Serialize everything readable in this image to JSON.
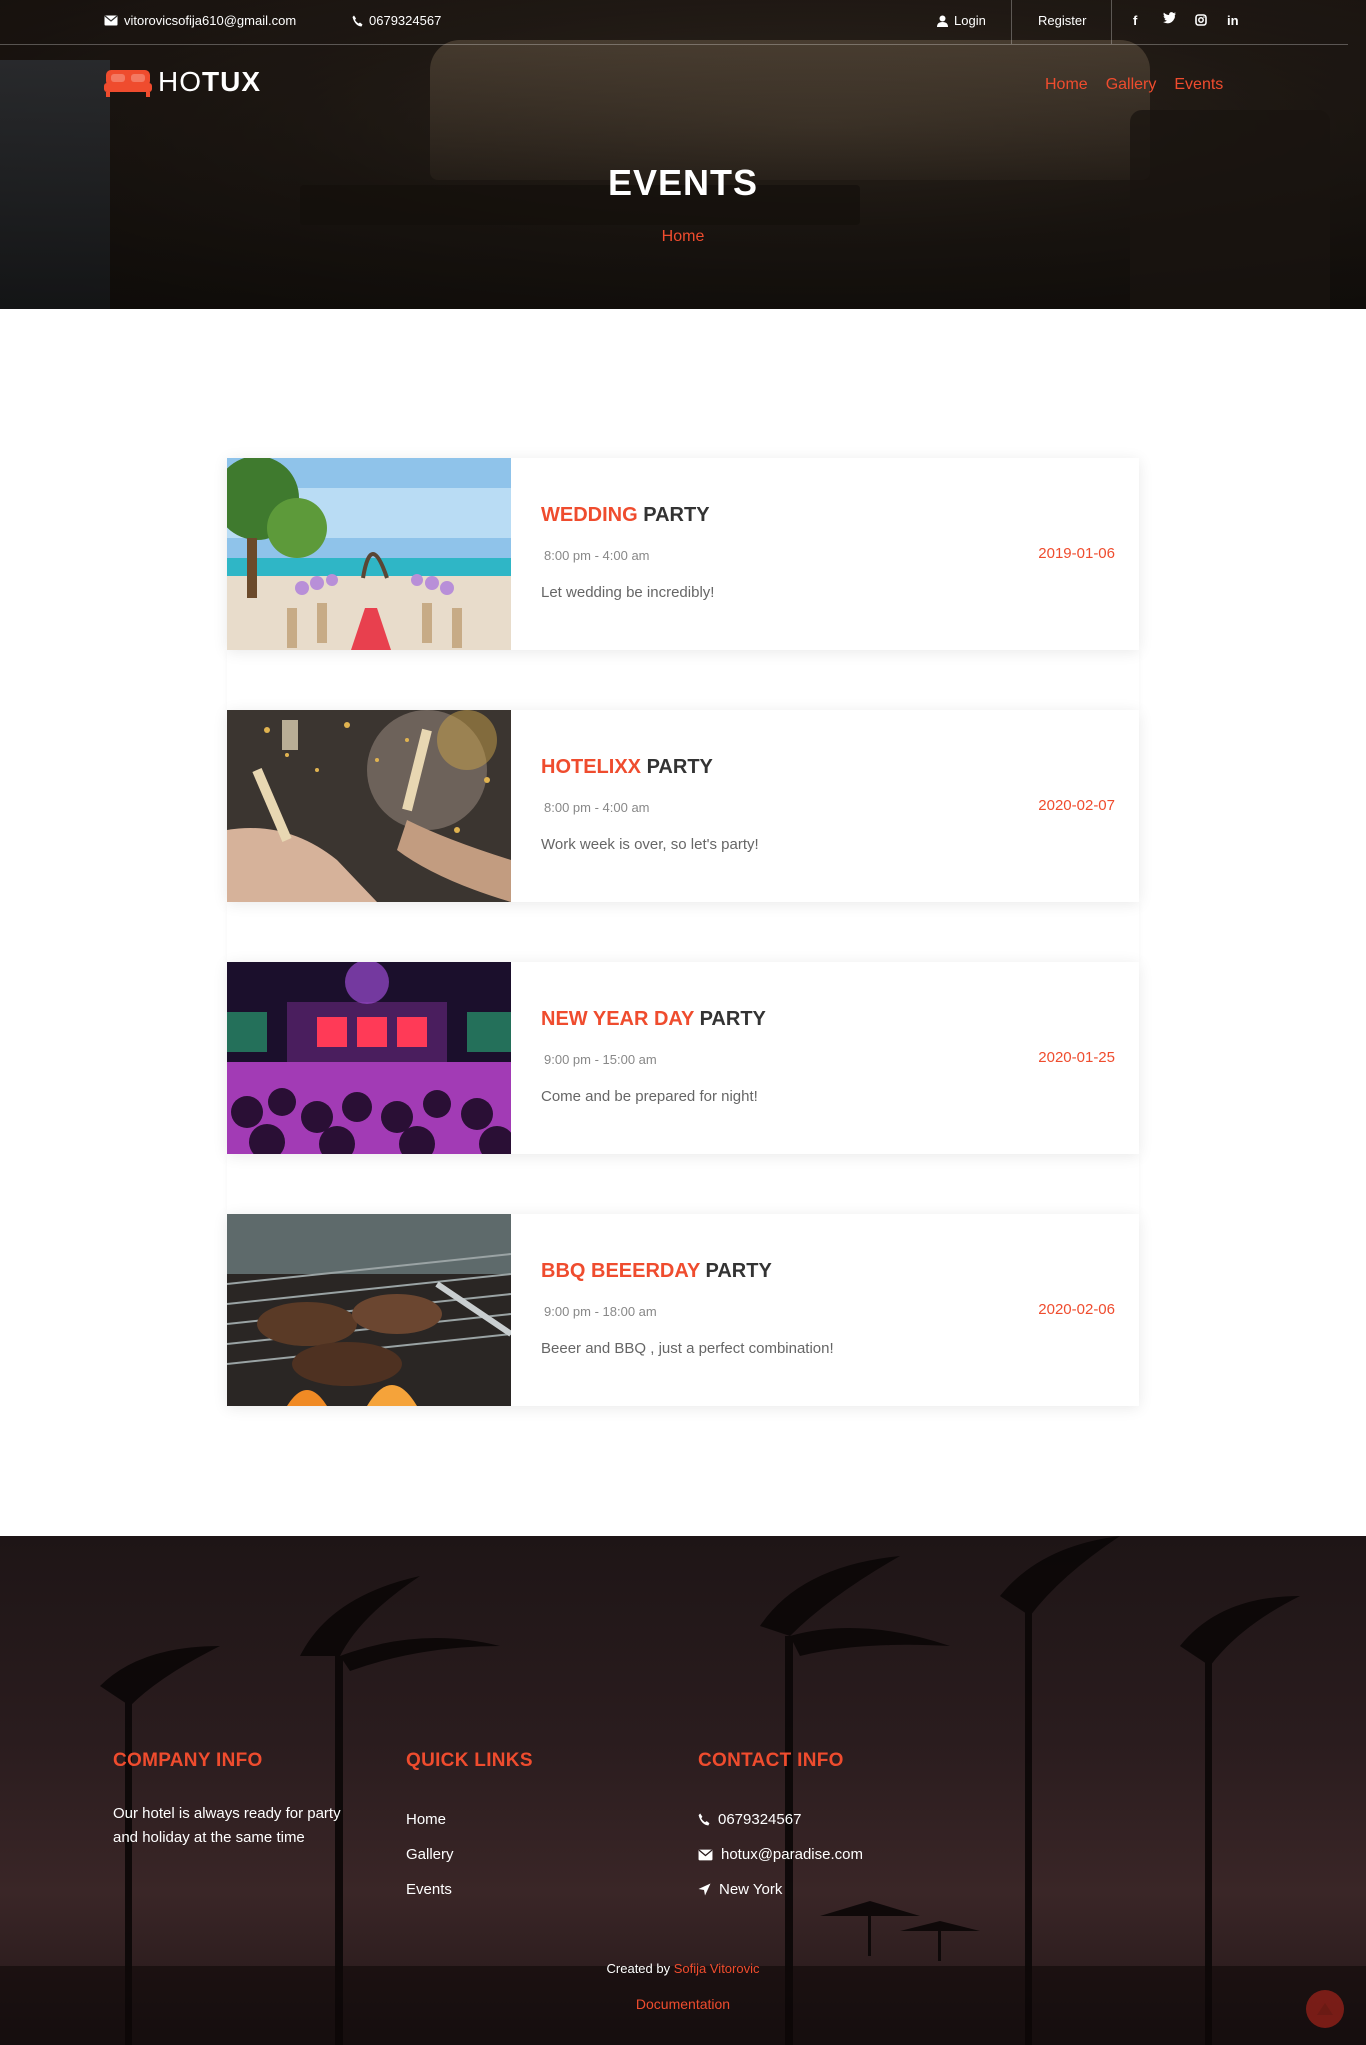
{
  "topbar": {
    "email": "vitorovicsofija610@gmail.com",
    "phone": "0679324567",
    "login": "Login",
    "register": "Register",
    "social": [
      "f",
      "t",
      "ig",
      "in"
    ]
  },
  "logo": {
    "light": "HO",
    "bold": "TUX"
  },
  "nav": [
    {
      "label": "Home"
    },
    {
      "label": "Gallery"
    },
    {
      "label": "Events"
    }
  ],
  "hero": {
    "title": "EVENTS",
    "breadcrumb": "Home"
  },
  "events": [
    {
      "accent": "WEDDING",
      "rest": "PARTY",
      "time": "8:00 pm - 4:00 am",
      "desc": "Let wedding be incredibly!",
      "date": "2019-01-06"
    },
    {
      "accent": "HOTELIXX",
      "rest": "PARTY",
      "time": "8:00 pm - 4:00 am",
      "desc": "Work week is over, so let's party!",
      "date": "2020-02-07"
    },
    {
      "accent": "NEW YEAR DAY",
      "rest": "PARTY",
      "time": "9:00 pm - 15:00 am",
      "desc": "Come and be prepared for night!",
      "date": "2020-01-25"
    },
    {
      "accent": "BBQ BEEERDAY",
      "rest": "PARTY",
      "time": "9:00 pm - 18:00 am",
      "desc": "Beeer and BBQ , just a perfect combination!",
      "date": "2020-02-06"
    }
  ],
  "footer": {
    "company_title": "COMPANY INFO",
    "company_text_1": "Our hotel is always ready for party",
    "company_text_2": "and holiday at the same time",
    "links_title": "QUICK LINKS",
    "links": [
      "Home",
      "Gallery",
      "Events"
    ],
    "contact_title": "CONTACT INFO",
    "contact_phone": "0679324567",
    "contact_email": "hotux@paradise.com",
    "contact_location": "New York",
    "credit_prefix": "Created by",
    "credit_author": "Sofija Vitorovic",
    "documentation": "Documentation"
  },
  "colors": {
    "accent": "#ef4c2e"
  }
}
